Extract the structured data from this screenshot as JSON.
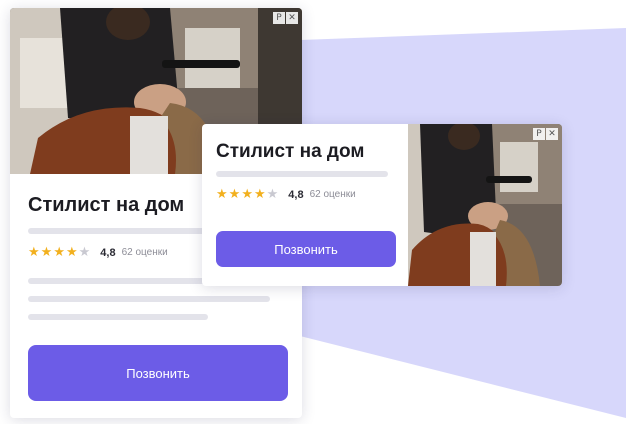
{
  "colors": {
    "accent": "#6c5ce7",
    "background_shape": "#d7d7fb",
    "star_filled": "#f2b01e",
    "star_empty": "#c9c9d1"
  },
  "card_large": {
    "title": "Стилист на дом",
    "rating_value": "4,8",
    "rating_count": "62 оценки",
    "stars_filled": 4,
    "stars_total": 5,
    "call_button_label": "Позвонить",
    "ad_badge_label": "Р",
    "close_icon": "close-icon"
  },
  "card_small": {
    "title": "Стилист на дом",
    "rating_value": "4,8",
    "rating_count": "62 оценки",
    "stars_filled": 4,
    "stars_total": 5,
    "call_button_label": "Позвонить",
    "ad_badge_label": "Р",
    "close_icon": "close-icon"
  }
}
